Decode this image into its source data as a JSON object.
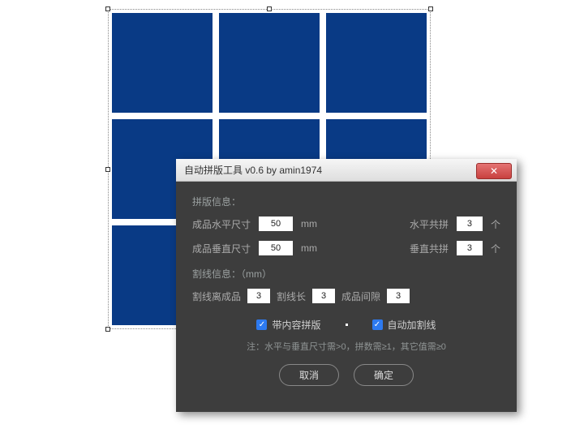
{
  "canvas": {
    "grid_rows": 3,
    "grid_cols": 3,
    "tile_color": "#093a85"
  },
  "dialog": {
    "title": "自动拼版工具 v0.6  by amin1974",
    "close_symbol": "✕",
    "section_layout": "拼版信息：",
    "labels": {
      "finished_h": "成品水平尺寸",
      "finished_v": "成品垂直尺寸",
      "h_count": "水平共拼",
      "v_count": "垂直共拼",
      "unit_mm": "mm",
      "unit_piece": "个"
    },
    "values": {
      "finished_h": "50",
      "finished_v": "50",
      "h_count": "3",
      "v_count": "3"
    },
    "section_cutline": "割线信息：（mm）",
    "cutline_labels": {
      "offset": "割线离成品",
      "length": "割线长",
      "gap": "成品间隙"
    },
    "cutline_values": {
      "offset": "3",
      "length": "3",
      "gap": "3"
    },
    "checkboxes": {
      "with_content": "带内容拼版",
      "auto_cutline": "自动加割线"
    },
    "note": "注：水平与垂直尺寸需>0，拼数需≥1，其它值需≥0",
    "buttons": {
      "cancel": "取消",
      "ok": "确定"
    }
  }
}
